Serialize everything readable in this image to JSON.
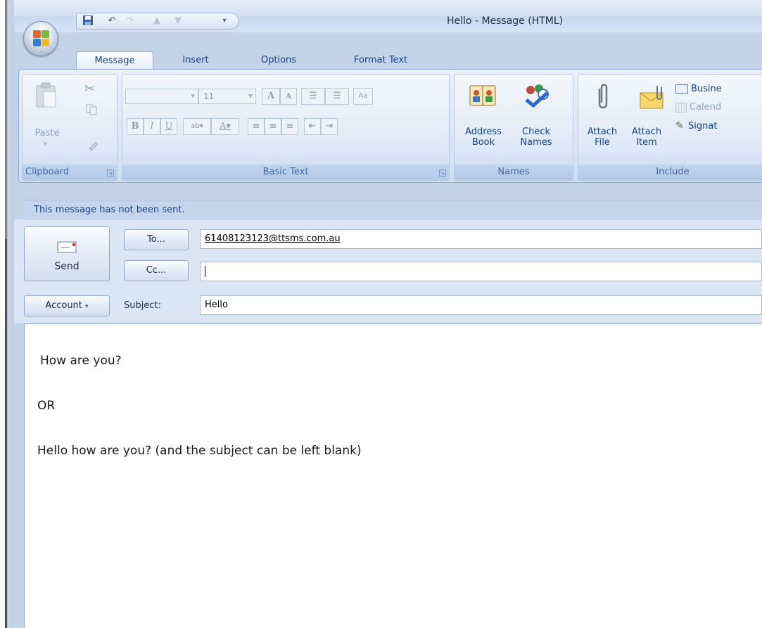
{
  "window": {
    "title": "Hello - Message (HTML)"
  },
  "ribbon": {
    "tabs": [
      "Message",
      "Insert",
      "Options",
      "Format Text"
    ],
    "active_tab": "Message",
    "clipboard": {
      "label": "Clipboard",
      "paste": "Paste"
    },
    "basic_text": {
      "label": "Basic Text",
      "font_size": "11"
    },
    "names": {
      "label": "Names",
      "address_book": [
        "Address",
        "Book"
      ],
      "check_names": [
        "Check",
        "Names"
      ]
    },
    "include": {
      "label": "Include",
      "attach_file": [
        "Attach",
        "File"
      ],
      "attach_item": [
        "Attach",
        "Item"
      ],
      "business_card": "Busine",
      "calendar": "Calend",
      "signature": "Signat"
    }
  },
  "infobar": {
    "text": "This message has not been sent."
  },
  "header": {
    "send_label": "Send",
    "to_button": "To...",
    "cc_button": "Cc...",
    "account_button": "Account",
    "subject_label": "Subject:",
    "to_value": "61408123123@ttsms.com.au",
    "cc_value": "",
    "subject_value": "Hello"
  },
  "body": {
    "lines": [
      "How are you?",
      "OR",
      "Hello how are you? (and the subject can be left blank)"
    ]
  },
  "colors": {
    "ribbon_text": "#15428b",
    "infobar_bg": "#c5d6ec",
    "header_bg": "#dbe6f4"
  }
}
